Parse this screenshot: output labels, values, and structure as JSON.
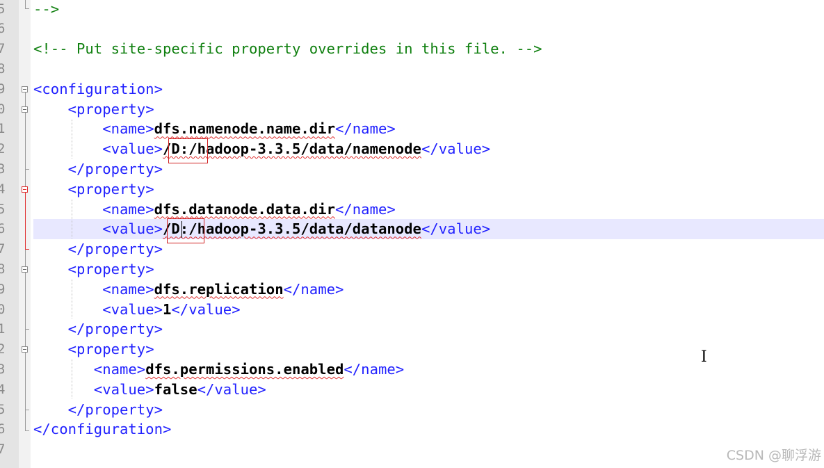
{
  "editor": {
    "lines": [
      {
        "num": "5",
        "tokens": [
          {
            "t": "-->",
            "c": "cmt"
          }
        ]
      },
      {
        "num": "6",
        "tokens": []
      },
      {
        "num": "7",
        "tokens": [
          {
            "t": "<!-- Put site-specific property overrides in this file. -->",
            "c": "cmt"
          }
        ]
      },
      {
        "num": "8",
        "tokens": []
      },
      {
        "num": "9",
        "tokens": [
          {
            "t": "<configuration>",
            "c": "tag"
          }
        ]
      },
      {
        "num": "0",
        "tokens": [
          {
            "t": "    "
          },
          {
            "t": "<property>",
            "c": "tag"
          }
        ]
      },
      {
        "num": "1",
        "tokens": [
          {
            "t": "        "
          },
          {
            "t": "<name>",
            "c": "tag"
          },
          {
            "t": "dfs.namenode.name.dir",
            "c": "val",
            "sq": true
          },
          {
            "t": "</name>",
            "c": "tag"
          }
        ]
      },
      {
        "num": "2",
        "tokens": [
          {
            "t": "        "
          },
          {
            "t": "<value>",
            "c": "tag"
          },
          {
            "t": "/D:/hadoop-3.3.5/data/namenode",
            "c": "val",
            "sq": true
          },
          {
            "t": "</value>",
            "c": "tag"
          }
        ]
      },
      {
        "num": "3",
        "tokens": [
          {
            "t": "    "
          },
          {
            "t": "</property>",
            "c": "tag"
          }
        ]
      },
      {
        "num": "4",
        "tokens": [
          {
            "t": "    "
          },
          {
            "t": "<property>",
            "c": "tag"
          }
        ]
      },
      {
        "num": "5",
        "tokens": [
          {
            "t": "        "
          },
          {
            "t": "<name>",
            "c": "tag"
          },
          {
            "t": "dfs.datanode.data.dir",
            "c": "val",
            "sq": true
          },
          {
            "t": "</name>",
            "c": "tag"
          }
        ]
      },
      {
        "num": "6",
        "tokens": [
          {
            "t": "        "
          },
          {
            "t": "<value>",
            "c": "tag"
          },
          {
            "t": "/D:/hadoop-3.3.5/data/datanode",
            "c": "val",
            "sq": true
          },
          {
            "t": "</value>",
            "c": "tag"
          }
        ],
        "current": true
      },
      {
        "num": "7",
        "tokens": [
          {
            "t": "    "
          },
          {
            "t": "</property>",
            "c": "tag"
          }
        ]
      },
      {
        "num": "8",
        "tokens": [
          {
            "t": "    "
          },
          {
            "t": "<property>",
            "c": "tag"
          }
        ]
      },
      {
        "num": "9",
        "tokens": [
          {
            "t": "        "
          },
          {
            "t": "<name>",
            "c": "tag"
          },
          {
            "t": "dfs.replication",
            "c": "val",
            "sq": true
          },
          {
            "t": "</name>",
            "c": "tag"
          }
        ]
      },
      {
        "num": "0",
        "tokens": [
          {
            "t": "        "
          },
          {
            "t": "<value>",
            "c": "tag"
          },
          {
            "t": "1",
            "c": "val"
          },
          {
            "t": "</value>",
            "c": "tag"
          }
        ]
      },
      {
        "num": "1",
        "tokens": [
          {
            "t": "    "
          },
          {
            "t": "</property>",
            "c": "tag"
          }
        ]
      },
      {
        "num": "2",
        "tokens": [
          {
            "t": "    "
          },
          {
            "t": "<property>",
            "c": "tag"
          }
        ]
      },
      {
        "num": "3",
        "tokens": [
          {
            "t": "       "
          },
          {
            "t": "<name>",
            "c": "tag"
          },
          {
            "t": "dfs.permissions.enabled",
            "c": "val",
            "sq": true
          },
          {
            "t": "</name>",
            "c": "tag"
          }
        ]
      },
      {
        "num": "4",
        "tokens": [
          {
            "t": "       "
          },
          {
            "t": "<value>",
            "c": "tag"
          },
          {
            "t": "false",
            "c": "val"
          },
          {
            "t": "</value>",
            "c": "tag"
          }
        ]
      },
      {
        "num": "5",
        "tokens": [
          {
            "t": "    "
          },
          {
            "t": "</property>",
            "c": "tag"
          }
        ]
      },
      {
        "num": "6",
        "tokens": [
          {
            "t": "</configuration>",
            "c": "tag"
          }
        ]
      },
      {
        "num": "7",
        "tokens": []
      }
    ]
  },
  "colors": {
    "tag": "#2222ff",
    "comment": "#108010",
    "text": "#000000",
    "current_line": "#e8e8ff",
    "annotation_box": "#d02020"
  },
  "watermark": "CSDN @聊浮游"
}
